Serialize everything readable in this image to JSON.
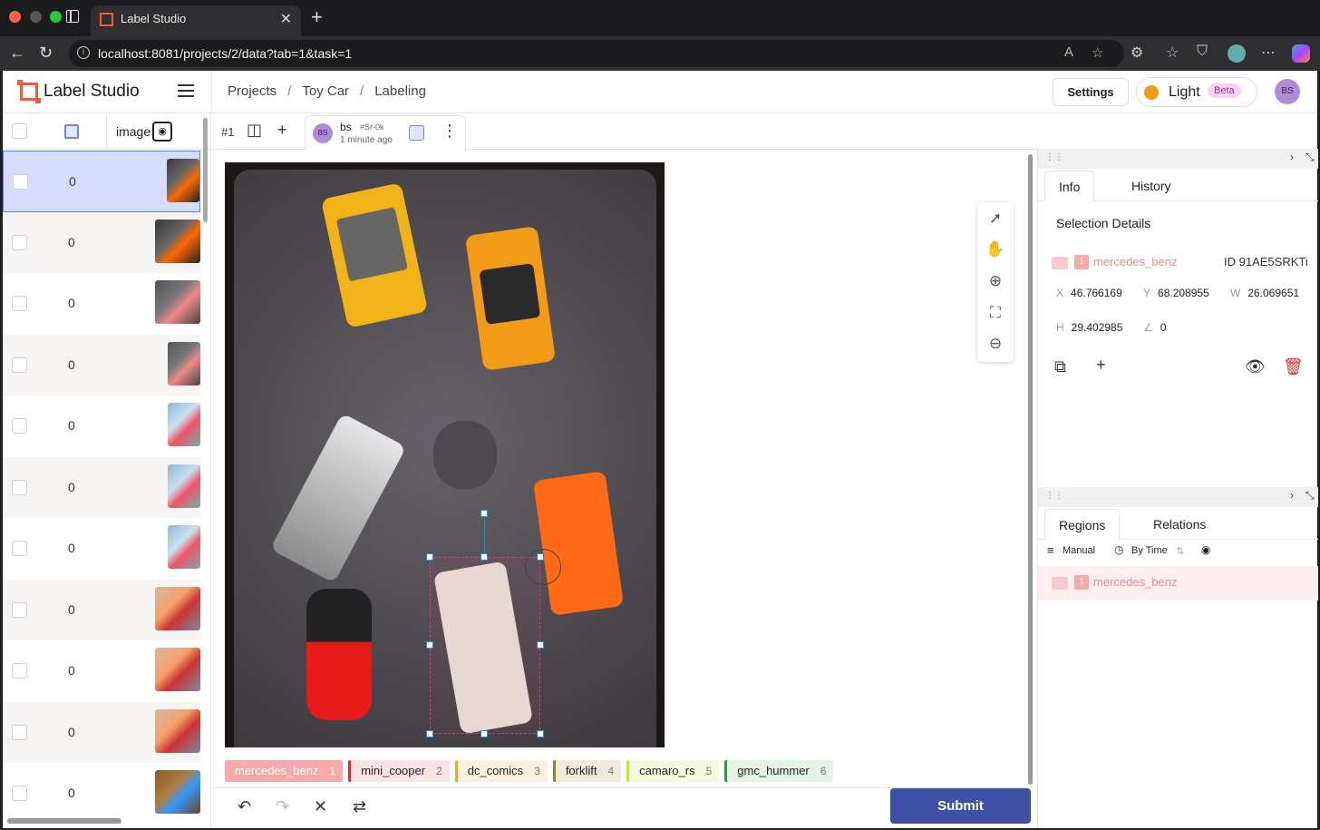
{
  "browser": {
    "tab_title": "Label Studio",
    "url": "localhost:8081/projects/2/data?tab=1&task=1"
  },
  "app": {
    "name": "Label Studio",
    "breadcrumbs": [
      "Projects",
      "Toy Car",
      "Labeling"
    ],
    "settings_label": "Settings",
    "theme_label": "Light",
    "theme_badge": "Beta",
    "user_initials": "BS"
  },
  "list": {
    "column_image": "image",
    "rows": [
      {
        "count": "0",
        "selected": true
      },
      {
        "count": "0"
      },
      {
        "count": "0"
      },
      {
        "count": "0"
      },
      {
        "count": "0"
      },
      {
        "count": "0"
      },
      {
        "count": "0"
      },
      {
        "count": "0"
      },
      {
        "count": "0"
      },
      {
        "count": "0"
      },
      {
        "count": "0"
      }
    ]
  },
  "annotation": {
    "task_id": "#1",
    "user": "bs",
    "hash": "#Sr-0k",
    "time": "1 minute ago",
    "user_initials": "BS"
  },
  "labels": [
    {
      "name": "mercedes_benz",
      "hotkey": "1",
      "color": "#f7a9a8",
      "active": true
    },
    {
      "name": "mini_cooper",
      "hotkey": "2",
      "color": "#d32f2f"
    },
    {
      "name": "dc_comics",
      "hotkey": "3",
      "color": "#f5a623"
    },
    {
      "name": "forklift",
      "hotkey": "4",
      "color": "#9b7b2c"
    },
    {
      "name": "camaro_rs",
      "hotkey": "5",
      "color": "#c6e52b"
    },
    {
      "name": "gmc_hummer",
      "hotkey": "6",
      "color": "#2e9b3e"
    }
  ],
  "actions": {
    "submit_label": "Submit"
  },
  "side_panel": {
    "tabs_top": [
      "Info",
      "History"
    ],
    "selection_title": "Selection Details",
    "region": {
      "index": "1",
      "label": "mercedes_benz",
      "id_key": "ID",
      "id": "91AE5SRKTi",
      "x_key": "X",
      "x": "46.766169",
      "y_key": "Y",
      "y": "68.208955",
      "w_key": "W",
      "w": "26.069651",
      "h_key": "H",
      "h": "29.402985",
      "angle_key": "∠",
      "angle": "0"
    },
    "tabs_bottom": [
      "Regions",
      "Relations"
    ],
    "toolbar": {
      "manual": "Manual",
      "by_time": "By Time"
    }
  },
  "colors": {
    "accent": "#3f51a5",
    "brand": "#f25c3b",
    "selected_row": "#d4dcff",
    "region_color": "#f28a8f"
  }
}
